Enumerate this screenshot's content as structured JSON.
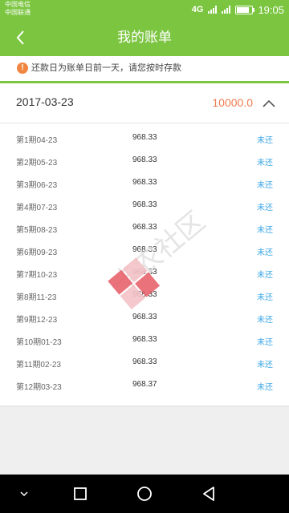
{
  "status_bar": {
    "carrier_1": "中国电信",
    "carrier_2": "中国联通",
    "network": "4G",
    "time": "19:05",
    "battery_level": 0.8
  },
  "header": {
    "title": "我的账单"
  },
  "notice": {
    "icon_symbol": "!",
    "text": "还款日为账单日前一天，请您按时存款"
  },
  "bill": {
    "date": "2017-03-23",
    "amount": "10000.0"
  },
  "installments": [
    {
      "period": "第1期04-23",
      "amount": "968.33",
      "status": "未还"
    },
    {
      "period": "第2期05-23",
      "amount": "968.33",
      "status": "未还"
    },
    {
      "period": "第3期06-23",
      "amount": "968.33",
      "status": "未还"
    },
    {
      "period": "第4期07-23",
      "amount": "968.33",
      "status": "未还"
    },
    {
      "period": "第5期08-23",
      "amount": "968.33",
      "status": "未还"
    },
    {
      "period": "第6期09-23",
      "amount": "968.33",
      "status": "未还"
    },
    {
      "period": "第7期10-23",
      "amount": "968.33",
      "status": "未还"
    },
    {
      "period": "第8期11-23",
      "amount": "968.33",
      "status": "未还"
    },
    {
      "period": "第9期12-23",
      "amount": "968.33",
      "status": "未还"
    },
    {
      "period": "第10期01-23",
      "amount": "968.33",
      "status": "未还"
    },
    {
      "period": "第11期02-23",
      "amount": "968.33",
      "status": "未还"
    },
    {
      "period": "第12期03-23",
      "amount": "968.37",
      "status": "未还"
    }
  ],
  "watermark": {
    "text": "卡农社区"
  },
  "colors": {
    "brand_green": "#7bc540",
    "notice_orange": "#f0863f",
    "amount_orange": "#f07b4f",
    "status_blue": "#3ca7e6"
  },
  "icons": {
    "back": "chevron-left-icon",
    "collapse": "chevron-up-icon",
    "notice": "info-icon",
    "sys_back": "triangle-back-icon",
    "sys_home": "circle-home-icon",
    "sys_recent": "square-recent-icon",
    "sys_down": "chevron-down-icon"
  }
}
